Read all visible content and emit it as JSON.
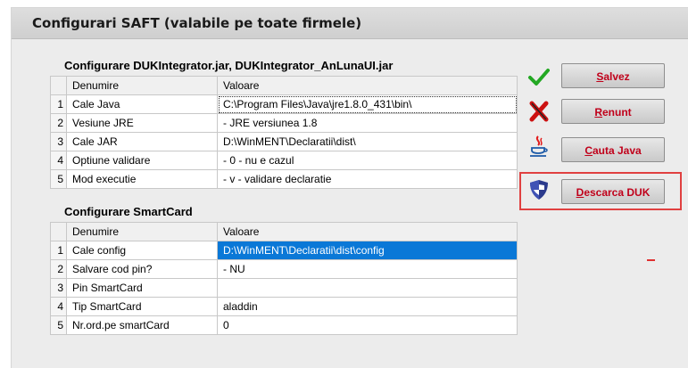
{
  "window": {
    "title": "Configurari SAFT (valabile pe toate firmele)"
  },
  "duk": {
    "section_title": "Configurare DUKIntegrator.jar, DUKIntegrator_AnLunaUI.jar",
    "headers": [
      "Denumire",
      "Valoare"
    ],
    "rows": [
      {
        "n": "1",
        "name": "Cale Java",
        "value": "C:\\Program Files\\Java\\jre1.8.0_431\\bin\\"
      },
      {
        "n": "2",
        "name": "Vesiune JRE",
        "value": "- JRE versiunea 1.8"
      },
      {
        "n": "3",
        "name": "Cale JAR",
        "value": "D:\\WinMENT\\Declaratii\\dist\\"
      },
      {
        "n": "4",
        "name": "Optiune validare",
        "value": "- 0 - nu e cazul"
      },
      {
        "n": "5",
        "name": "Mod executie",
        "value": "- v - validare declaratie"
      }
    ]
  },
  "smartcard": {
    "section_title": "Configurare SmartCard",
    "headers": [
      "Denumire",
      "Valoare"
    ],
    "rows": [
      {
        "n": "1",
        "name": "Cale config",
        "value": "D:\\WinMENT\\Declaratii\\dist\\config"
      },
      {
        "n": "2",
        "name": "Salvare cod pin?",
        "value": "- NU"
      },
      {
        "n": "3",
        "name": "Pin SmartCard",
        "value": ""
      },
      {
        "n": "4",
        "name": "Tip SmartCard",
        "value": "aladdin"
      },
      {
        "n": "5",
        "name": "Nr.ord.pe smartCard",
        "value": "0"
      }
    ]
  },
  "buttons": {
    "save": {
      "hotkey": "S",
      "rest": "alvez"
    },
    "cancel": {
      "hotkey": "R",
      "rest": "enunt"
    },
    "java": {
      "hotkey": "C",
      "rest": "auta Java"
    },
    "duk": {
      "hotkey": "D",
      "rest": "escarca DUK"
    }
  },
  "icons": {
    "save": "checkmark-icon",
    "cancel": "red-x-icon",
    "java": "java-cup-icon",
    "duk": "shield-icon"
  },
  "colors": {
    "selection": "#0a78d7",
    "button_text": "#c0001a",
    "highlight_box": "#e04040"
  }
}
